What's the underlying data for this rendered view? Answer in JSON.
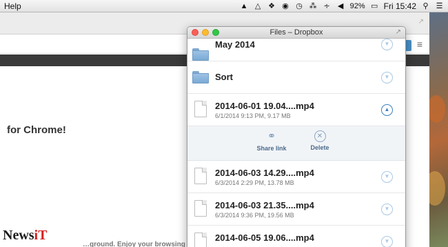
{
  "menubar": {
    "help": "Help",
    "battery": "92%",
    "clock": "Fri 15:42"
  },
  "browser": {
    "headline": "for Chrome!",
    "bottom_text": "…ground. Enjoy your browsing in"
  },
  "watermark": {
    "text_news": "News",
    "text_it": "iT"
  },
  "dropbox": {
    "title": "Files – Dropbox",
    "items": [
      {
        "type": "folder",
        "name": "May 2014",
        "meta": ""
      },
      {
        "type": "folder",
        "name": "Sort",
        "meta": ""
      },
      {
        "type": "file",
        "name": "2014-06-01 19.04....mp4",
        "meta": "6/1/2014 9:13 PM, 9.17 MB",
        "expanded": true
      },
      {
        "type": "file",
        "name": "2014-06-03 14.29....mp4",
        "meta": "6/3/2014 2:29 PM, 13.78 MB"
      },
      {
        "type": "file",
        "name": "2014-06-03 21.35....mp4",
        "meta": "6/3/2014 9:36 PM, 19.56 MB"
      },
      {
        "type": "file",
        "name": "2014-06-05 19.06....mp4",
        "meta": ""
      }
    ],
    "actions": {
      "share": "Share link",
      "delete": "Delete"
    }
  },
  "colors": {
    "accent": "#3a7fc0",
    "chevron": "#a9c8e4",
    "action_label": "#4b6a8c",
    "folder": "#7aaad6"
  }
}
